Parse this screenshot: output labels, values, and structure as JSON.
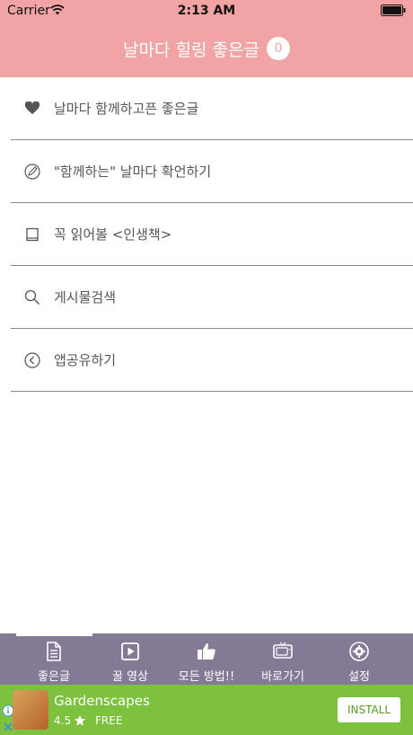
{
  "status_bar": {
    "carrier": "Carrier",
    "time": "2:13 AM"
  },
  "nav": {
    "title": "날마다 힐링 좋은글",
    "badge_count": "0"
  },
  "menu": [
    {
      "label": "날마다 함께하고픈 좋은글",
      "icon": "heart-icon"
    },
    {
      "label": "\"함께하는\" 날마다 확언하기",
      "icon": "pencil-circle-icon"
    },
    {
      "label": "꼭 읽어볼 <인생책>",
      "icon": "book-icon"
    },
    {
      "label": "게시물검색",
      "icon": "search-icon"
    },
    {
      "label": "앱공유하기",
      "icon": "share-back-icon"
    }
  ],
  "tabbar": [
    {
      "label": "좋은글",
      "icon": "document-icon"
    },
    {
      "label": "꿀 영상",
      "icon": "play-icon"
    },
    {
      "label": "모든 방법!!",
      "icon": "thumbs-up-icon"
    },
    {
      "label": "바로가기",
      "icon": "tv-icon"
    },
    {
      "label": "설정",
      "icon": "gear-icon"
    }
  ],
  "ad": {
    "title": "Gardenscapes",
    "rating": "4.5",
    "price": "FREE",
    "install_label": "INSTALL"
  },
  "colors": {
    "header": "#f2a3a3",
    "tabbar": "#857a96",
    "ad": "#7dc23e"
  }
}
